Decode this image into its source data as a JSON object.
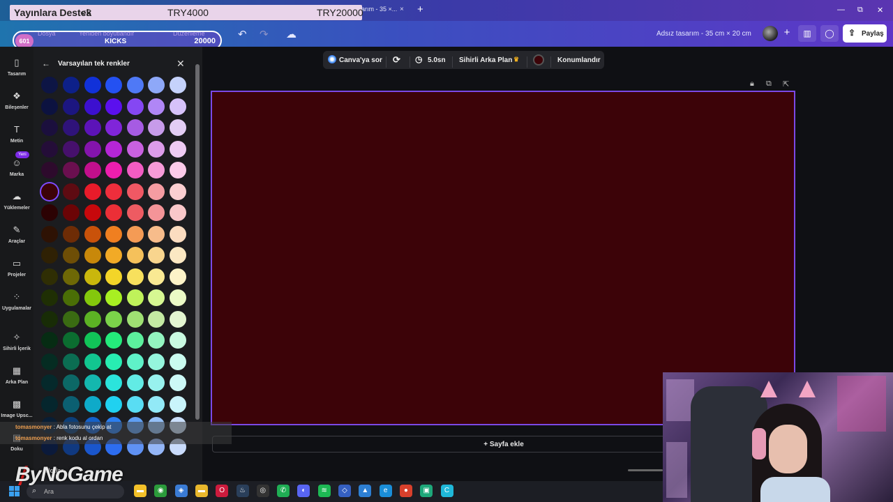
{
  "browser": {
    "tab_fragment": "arım - 35 ×...",
    "tab_close": "×",
    "new_tab": "+",
    "window_min": "—",
    "window_restore": "⧉",
    "window_close": "✕"
  },
  "donation": {
    "title": "Yayınlara Destek",
    "heart": "<3",
    "current": "TRY4000",
    "goal": "TRY20000"
  },
  "kicks": {
    "badge": "601",
    "label": "KICKS",
    "value": "20000"
  },
  "menu": {
    "file": "Dosya",
    "resize": "Yeniden boyutlandır",
    "editing": "Düzenleme"
  },
  "toolbar": {
    "doc_title": "Adsız tasarım - 35 cm × 20 cm",
    "share_label": "Paylaş",
    "plus": "+"
  },
  "rail": [
    {
      "label": "Tasarım",
      "icon": "▯"
    },
    {
      "label": "Bileşenler",
      "icon": "❖"
    },
    {
      "label": "Metin",
      "icon": "T"
    },
    {
      "label": "Marka",
      "icon": "☺"
    },
    {
      "label": "Yüklemeler",
      "icon": "☁"
    },
    {
      "label": "Araçlar",
      "icon": "✎"
    },
    {
      "label": "Projeler",
      "icon": "▭"
    },
    {
      "label": "Uygulamalar",
      "icon": "⁘"
    },
    {
      "label": "Sihirli İçerik",
      "icon": "✧"
    },
    {
      "label": "Arka Plan",
      "icon": "▦"
    },
    {
      "label": "Image Upsc...",
      "icon": "▩"
    },
    {
      "label": "Doku",
      "icon": "▤"
    }
  ],
  "rail_new_badge": "Yeni",
  "panel": {
    "title": "Varsayılan tek renkler",
    "back_icon": "←",
    "close_icon": "✕",
    "rows": [
      [
        "#0d1545",
        "#0d2089",
        "#1131d9",
        "#2451f2",
        "#4f79f6",
        "#8ea8f8",
        "#c5d2fb"
      ],
      [
        "#0c1240",
        "#1c1680",
        "#3c10cf",
        "#5b10ee",
        "#8547f3",
        "#b086f6",
        "#d6c2fa"
      ],
      [
        "#1b0f3d",
        "#2f137a",
        "#5c13b8",
        "#8025d9",
        "#a65be3",
        "#c79bea",
        "#e2cdf4"
      ],
      [
        "#240d38",
        "#46106c",
        "#8414ac",
        "#b526d6",
        "#c961e0",
        "#dc9ce9",
        "#eecbf3"
      ],
      [
        "#2d0a2c",
        "#6a0f4f",
        "#c20f8c",
        "#ed1eae",
        "#f25cc3",
        "#f69bd8",
        "#fbcbe9"
      ],
      [
        "#3c0308",
        "#5e0b12",
        "#e81b2a",
        "#ee2e3c",
        "#f05864",
        "#f59ca2",
        "#fbcfd1"
      ],
      [
        "#2c0203",
        "#6b0406",
        "#c7080c",
        "#ec2f37",
        "#ee5b62",
        "#f49498",
        "#f9c8ca"
      ],
      [
        "#2e1204",
        "#6e2c06",
        "#c9520a",
        "#f07f20",
        "#f49b55",
        "#f7bc8b",
        "#fbdcc0"
      ],
      [
        "#2f2104",
        "#6e4e06",
        "#c8880a",
        "#f2aa26",
        "#f5c15b",
        "#f8d58e",
        "#fbe8c3"
      ],
      [
        "#2f2e04",
        "#6e6806",
        "#c9b70c",
        "#f3d528",
        "#f7e05d",
        "#f9e993",
        "#fcf3c8"
      ],
      [
        "#1f2f04",
        "#4a6e06",
        "#84c80c",
        "#a8ef22",
        "#bff25a",
        "#d6f792",
        "#ebfac6"
      ],
      [
        "#182c06",
        "#3a6b12",
        "#5cb224",
        "#7bd34a",
        "#9fe073",
        "#c4eaa3",
        "#e3f5d1"
      ],
      [
        "#062c13",
        "#0b6d30",
        "#11c458",
        "#24eb7b",
        "#5cf09d",
        "#93f5c0",
        "#c9fae1"
      ],
      [
        "#052c22",
        "#0b6d52",
        "#12c690",
        "#28edb2",
        "#5ff2c8",
        "#95f6dd",
        "#cafbef"
      ],
      [
        "#05292b",
        "#0c6866",
        "#14b7ae",
        "#2be4dc",
        "#62ebe5",
        "#98f2ee",
        "#ccf8f6"
      ],
      [
        "#05262d",
        "#0b5f71",
        "#0eaac9",
        "#20d1f0",
        "#59ddf3",
        "#92e9f7",
        "#c9f4fb"
      ],
      [
        "#081e35",
        "#0c3f78",
        "#1461c9",
        "#2b7ff0",
        "#5f9ff3",
        "#95c0f7",
        "#cadffb"
      ],
      [
        "#0b1a3b",
        "#103980",
        "#1a56cc",
        "#2d6df0",
        "#5f91f3",
        "#94b6f7",
        "#c9dbfb"
      ]
    ]
  },
  "context_bar": {
    "ask": "Canva'ya sor",
    "duration": "5.0sn",
    "magic_bg": "Sihirli Arka Plan",
    "position": "Konumlandır",
    "current_color": "#3c0308"
  },
  "canvas": {
    "background": "#3c0308",
    "add_page": "+ Sayfa ekle"
  },
  "chat": [
    {
      "user": "tomasmonyer",
      "text": " : Abla fotosunu çekip at"
    },
    {
      "user": "tomasmonyer",
      "text": " : renk kodu al ordan"
    }
  ],
  "notes_label": "Notlar",
  "logo_text": "ByNoGame",
  "taskbar": {
    "search_placeholder": "Ara",
    "apps": [
      {
        "name": "file-explorer-icon",
        "color": "#f2c029",
        "glyph": "▬"
      },
      {
        "name": "xbox-icon",
        "color": "#2b9b3b",
        "glyph": "◉"
      },
      {
        "name": "app-icon",
        "color": "#3a7bd5",
        "glyph": "◈"
      },
      {
        "name": "folder-icon",
        "color": "#e8b72c",
        "glyph": "▬"
      },
      {
        "name": "opera-icon",
        "color": "#cc1b3d",
        "glyph": "O"
      },
      {
        "name": "steam-icon",
        "color": "#2a3f5a",
        "glyph": "♨"
      },
      {
        "name": "obs-icon",
        "color": "#333",
        "glyph": "◎"
      },
      {
        "name": "whatsapp-icon",
        "color": "#1fae54",
        "glyph": "✆"
      },
      {
        "name": "discord-icon",
        "color": "#5865f2",
        "glyph": "◐"
      },
      {
        "name": "spotify-icon",
        "color": "#1db954",
        "glyph": "≋"
      },
      {
        "name": "app2-icon",
        "color": "#3560c2",
        "glyph": "◇"
      },
      {
        "name": "photos-icon",
        "color": "#2d7fd3",
        "glyph": "▲"
      },
      {
        "name": "edge-icon",
        "color": "#1a8ed8",
        "glyph": "e"
      },
      {
        "name": "chrome-icon",
        "color": "#d8402c",
        "glyph": "●"
      },
      {
        "name": "app3-icon",
        "color": "#1ea87a",
        "glyph": "▣"
      },
      {
        "name": "canva-icon",
        "color": "#1fb8d9",
        "glyph": "C"
      }
    ]
  }
}
